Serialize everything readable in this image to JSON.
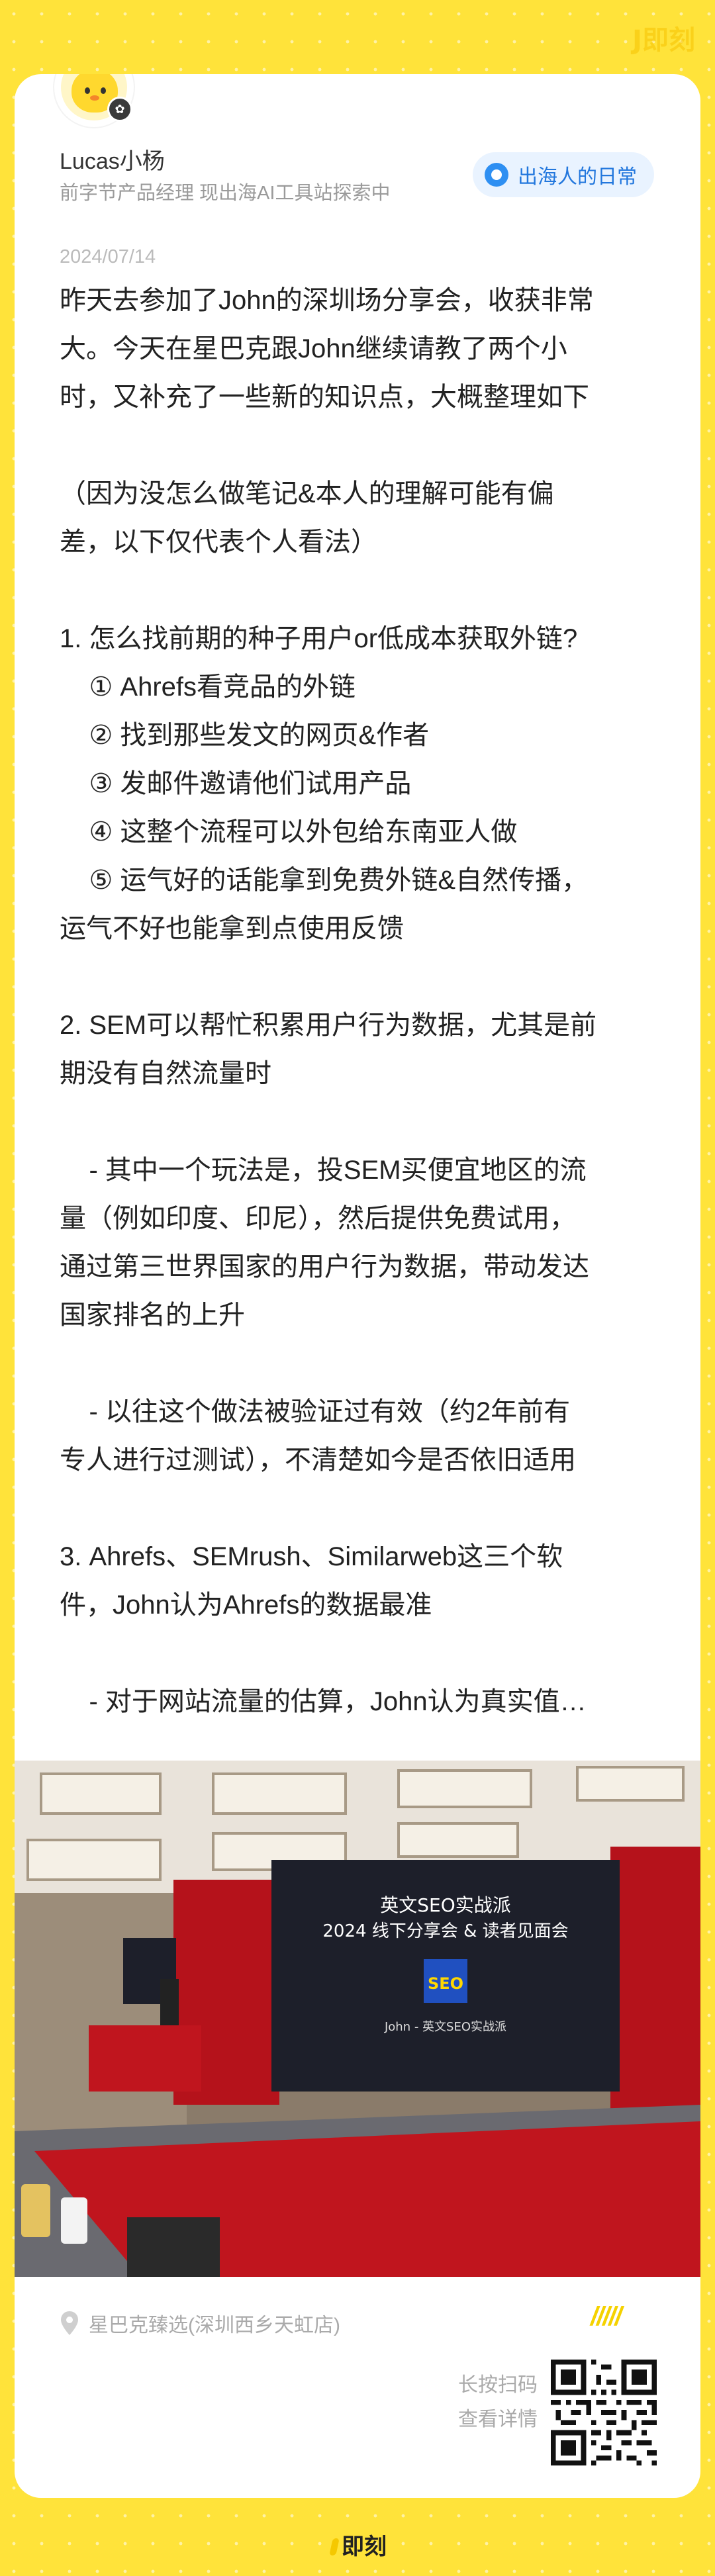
{
  "app": {
    "watermark": "J即刻",
    "footer_logo": "即刻"
  },
  "post": {
    "author": {
      "name": "Lucas小杨",
      "bio": "前字节产品经理 现出海AI工具站探索中"
    },
    "topic": "出海人的日常",
    "date": "2024/07/14",
    "content": "昨天去参加了John的深圳场分享会，收获非常\n大。今天在星巴克跟John继续请教了两个小\n时，又补充了一些新的知识点，大概整理如下\n\n（因为没怎么做笔记&本人的理解可能有偏\n差，以下仅代表个人看法）\n\n1. 怎么找前期的种子用户or低成本获取外链?\n    ① Ahrefs看竞品的外链\n    ② 找到那些发文的网页&作者\n    ③ 发邮件邀请他们试用产品\n    ④ 这整个流程可以外包给东南亚人做\n    ⑤ 运气好的话能拿到免费外链&自然传播，\n运气不好也能拿到点使用反馈\n\n2. SEM可以帮忙积累用户行为数据，尤其是前\n期没有自然流量时\n\n    - 其中一个玩法是，投SEM买便宜地区的流\n量（例如印度、印尼），然后提供免费试用，\n通过第三世界国家的用户行为数据，带动发达\n国家排名的上升\n\n    - 以往这个做法被验证过有效（约2年前有\n专人进行过测试），不清楚如今是否依旧适用\n\n3. Ahrefs、SEMrush、Similarweb这三个软\n件，John认为Ahrefs的数据最准\n\n    - 对于网站流量的估算，John认为真实值…",
    "photo": {
      "screen_line1": "英文SEO实战派",
      "screen_line2": "2024 线下分享会 & 读者见面会",
      "screen_logo": "SEO",
      "screen_footer": "John - 英文SEO实战派"
    },
    "location": "星巴克臻选(深圳西乡天虹店)"
  },
  "share": {
    "caption_line1": "长按扫码",
    "caption_line2": "查看详情",
    "slashes": "/////"
  },
  "colors": {
    "background": "#FFE33A",
    "accent_yellow": "#F5D200",
    "topic_blue": "#2277DD",
    "carpet_red": "#C0151E"
  }
}
